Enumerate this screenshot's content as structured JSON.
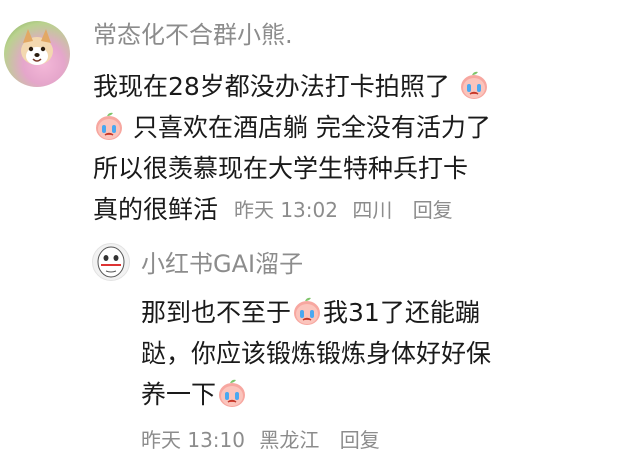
{
  "comment": {
    "username": "常态化不合群小熊.",
    "lines": [
      "我现在28岁都没办法打卡拍照了",
      "只喜欢在酒店躺 完全没有活力了",
      "所以很羡慕现在大学生特种兵打卡",
      "真的很鲜活"
    ],
    "time": "昨天 13:02",
    "location": "四川",
    "reply_label": "回复",
    "emoji_icon": "crying-peach-emoji-icon"
  },
  "reply": {
    "username": "小红书GAI溜子",
    "lines": [
      "那到也不至于",
      "我31了还能蹦",
      "跶，你应该锻炼锻炼身体好好保",
      "养一下"
    ],
    "time": "昨天 13:10",
    "location": "黑龙江",
    "reply_label": "回复",
    "emoji_icon": "crying-peach-emoji-icon"
  },
  "colors": {
    "username": "#8c8c8c",
    "text": "#1a1a1a",
    "meta": "#8c8c8c",
    "background": "#ffffff",
    "emoji_peach": "#f7a7a0"
  }
}
